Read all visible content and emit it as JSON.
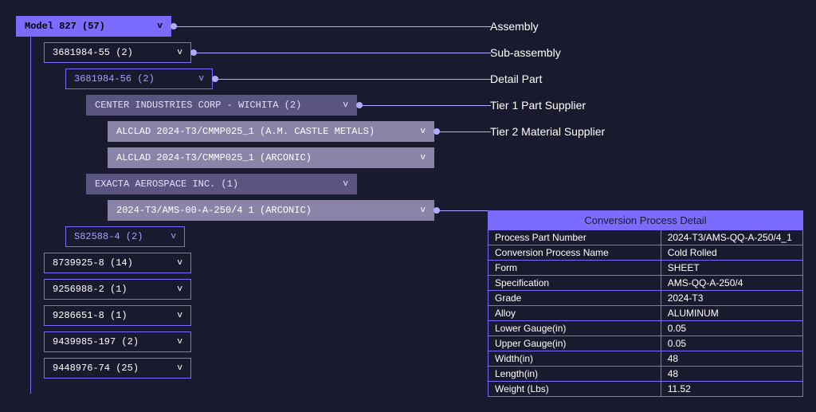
{
  "tree": {
    "root": {
      "label": "Model 827 (57)"
    },
    "sub1": {
      "label": "3681984-55 (2)"
    },
    "det1": {
      "label": "3681984-56 (2)"
    },
    "tier1a": {
      "label": "CENTER INDUSTRIES CORP - WICHITA (2)"
    },
    "tier2a": {
      "label": "ALCLAD 2024-T3/CMMP025_1 (A.M. CASTLE METALS)"
    },
    "tier2b": {
      "label": "ALCLAD 2024-T3/CMMP025_1 (ARCONIC)"
    },
    "tier1b": {
      "label": "EXACTA AEROSPACE INC. (1)"
    },
    "tier2c": {
      "label": "2024-T3/AMS-00-A-250/4 1 (ARCONIC)"
    },
    "det2": {
      "label": "S82588-4 (2)"
    },
    "sub2": {
      "label": "8739925-8 (14)"
    },
    "sub3": {
      "label": "9256988-2 (1)"
    },
    "sub4": {
      "label": "9286651-8 (1)"
    },
    "sub5": {
      "label": "9439985-197 (2)"
    },
    "sub6": {
      "label": "9448976-74 (25)"
    }
  },
  "legend": {
    "l1": "Assembly",
    "l2": "Sub-assembly",
    "l3": "Detail Part",
    "l4": "Tier 1 Part Supplier",
    "l5": "Tier 2 Material Supplier"
  },
  "detail": {
    "title": "Conversion Process Detail",
    "rows": [
      {
        "k": "Process Part Number",
        "v": "2024-T3/AMS-QQ-A-250/4_1"
      },
      {
        "k": "Conversion Process Name",
        "v": "Cold Rolled"
      },
      {
        "k": "Form",
        "v": "SHEET"
      },
      {
        "k": "Specification",
        "v": "AMS-QQ-A-250/4"
      },
      {
        "k": "Grade",
        "v": "2024-T3"
      },
      {
        "k": "Alloy",
        "v": "ALUMINUM"
      },
      {
        "k": "Lower Gauge(in)",
        "v": "0.05"
      },
      {
        "k": "Upper Gauge(in)",
        "v": "0.05"
      },
      {
        "k": "Width(in)",
        "v": "48"
      },
      {
        "k": "Length(in)",
        "v": "48"
      },
      {
        "k": "Weight (Lbs)",
        "v": "11.52"
      }
    ]
  },
  "chevron": "v"
}
